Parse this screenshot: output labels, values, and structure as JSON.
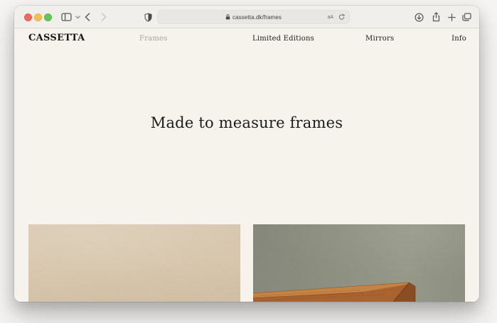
{
  "browser": {
    "url": "cassetta.dk/frames",
    "traffic_light_colors": {
      "close": "#ed6a5e",
      "minimize": "#f5bf4f",
      "zoom": "#62c554"
    },
    "url_field_icons": {
      "left": "lock-icon",
      "right": [
        "translate-icon",
        "reload-icon"
      ]
    },
    "toolbar_icons": [
      "sidebar-icon",
      "chevron-down-icon",
      "back-icon",
      "forward-icon",
      "privacy-shield-icon",
      "downloads-icon",
      "share-icon",
      "new-tab-icon",
      "tab-overview-icon"
    ],
    "translate_glyph": "aA"
  },
  "site": {
    "logo": "CASSETTA",
    "nav": [
      {
        "label": "Frames",
        "active": true
      },
      {
        "label": "Limited Editions",
        "active": false
      },
      {
        "label": "Mirrors",
        "active": false
      },
      {
        "label": "Info",
        "active": false
      }
    ],
    "heading": "Made to measure frames",
    "colors": {
      "page_background": "#f5f3ec",
      "text": "#1c1c1a",
      "nav_muted": "#a3a29b",
      "wall_beige": "#d9c8ae",
      "wall_green": "#8d9080",
      "wood_face": "#a96331",
      "wood_highlight": "#c58343",
      "wood_shadow": "#7a431d"
    },
    "images": [
      {
        "name": "beige-plaster-wall-photo"
      },
      {
        "name": "green-wall-wood-frame-corner-photo"
      }
    ]
  }
}
